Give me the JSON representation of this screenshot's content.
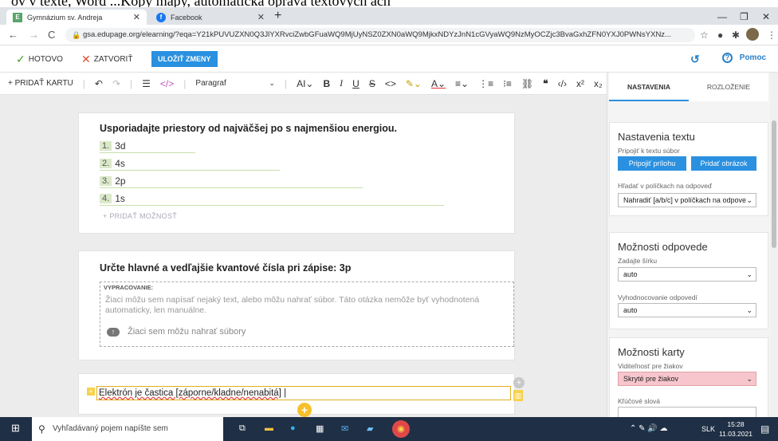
{
  "top_clip_text": "ov v texte, Word ...Kopy mapy, automatická oprava textových ách",
  "browser": {
    "tabs": [
      {
        "title": "Gymnázium sv. Andreja",
        "favicon": "edupage-icon",
        "active": true
      },
      {
        "title": "Facebook",
        "favicon": "facebook-icon",
        "active": false
      }
    ],
    "url": "gsa.edupage.org/elearning/?eqa=Y21kPUVUZXN0Q3JlYXRvciZwbGFuaWQ9MjUyNSZ0ZXN0aWQ9MjkxNDYzJnN1cGVyaWQ9NzMyOCZjc3BvaGxhZFN0YXJ0PWNsYXNz..."
  },
  "actionbar": {
    "done": "HOTOVO",
    "close": "ZATVORIŤ",
    "save": "ULOŽIŤ ZMENY",
    "help": "Pomoc"
  },
  "format": {
    "add_card": "+ PRIDAŤ KARTU",
    "paragraph": "Paragraf"
  },
  "q1": {
    "title": "Usporiadajte priestory od najväčšej po s najmenšiou energiou.",
    "options": [
      {
        "num": "1.",
        "text": "3d"
      },
      {
        "num": "2.",
        "text": "4s"
      },
      {
        "num": "3.",
        "text": "2p"
      },
      {
        "num": "4.",
        "text": "1s"
      }
    ],
    "add_option": "+ PRIDAŤ MOŽNOSŤ"
  },
  "q2": {
    "title": "Určte hlavné a vedľajšie kvantové čísla pri zápise: 3p",
    "label": "VYPRACOVANIE:",
    "hint": "Žiaci môžu sem napísať nejaký text, alebo môžu nahrať súbor. Táto otázka nemôže byť vyhodnotená automaticky, len manuálne.",
    "upload": "Žiaci sem môžu nahrať súbory"
  },
  "q3": {
    "text": "Elektrón je častica [záporne/kladne/nenabitá]"
  },
  "sidebar": {
    "tabs": [
      "NASTAVENIA",
      "ROZLOŽENIE"
    ],
    "text_settings": {
      "title": "Nastavenia textu",
      "attach_label": "Pripojiť k textu súbor",
      "btn_attach": "Pripojiť prílohu",
      "btn_image": "Pridať obrázok",
      "search_label": "Hľadať v políčkach na odpoveď",
      "search_value": "Nahradiť [a/b/c] v políčkach na odpove"
    },
    "answer_options": {
      "title": "Možnosti odpovede",
      "width_label": "Zadajte šírku",
      "width_value": "auto",
      "eval_label": "Vyhodnocovanie odpovedí",
      "eval_value": "auto"
    },
    "card_options": {
      "title": "Možnosti karty",
      "visibility_label": "Viditeľnosť pre žiakov",
      "visibility_value": "Skryté pre žiakov",
      "keywords_label": "Kľúčové slová"
    }
  },
  "taskbar": {
    "search": "Vyhľadávaný pojem napíšte sem",
    "lang": "SLK",
    "time": "15:28",
    "date": "11.03.2021"
  }
}
